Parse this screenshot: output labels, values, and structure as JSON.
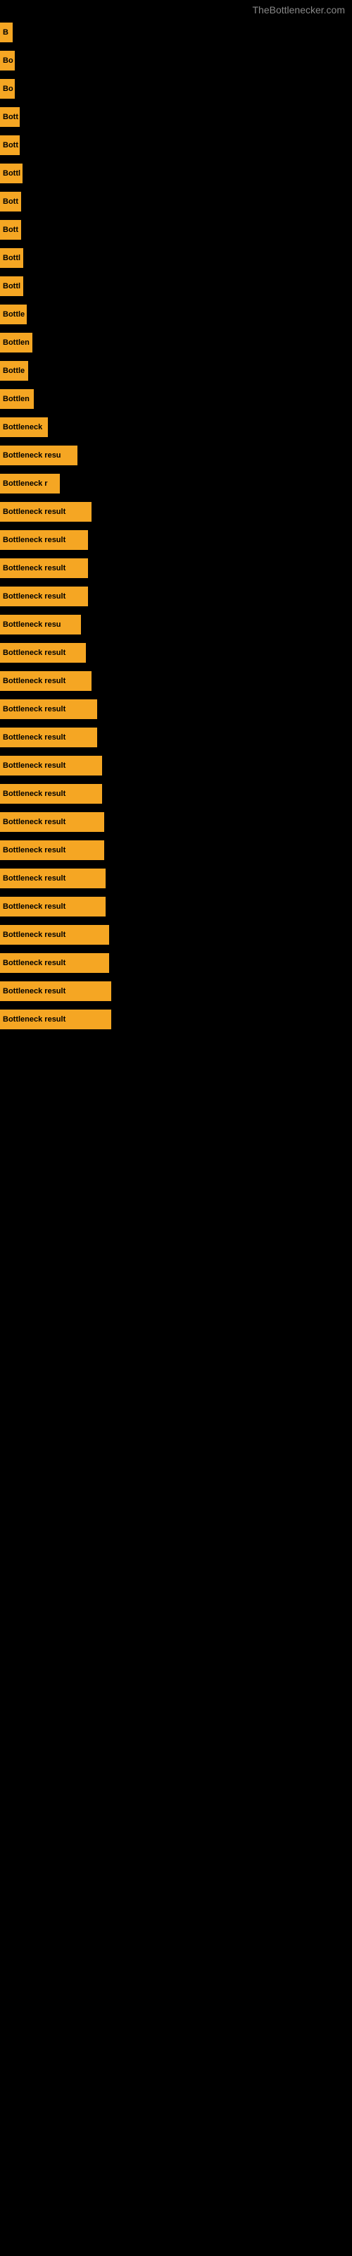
{
  "site_title": "TheBottlenecker.com",
  "bars": [
    {
      "label": "B",
      "width": 18
    },
    {
      "label": "Bo",
      "width": 21
    },
    {
      "label": "Bo",
      "width": 21
    },
    {
      "label": "Bott",
      "width": 28
    },
    {
      "label": "Bott",
      "width": 28
    },
    {
      "label": "Bottl",
      "width": 32
    },
    {
      "label": "Bott",
      "width": 30
    },
    {
      "label": "Bott",
      "width": 30
    },
    {
      "label": "Bottl",
      "width": 33
    },
    {
      "label": "Bottl",
      "width": 33
    },
    {
      "label": "Bottle",
      "width": 38
    },
    {
      "label": "Bottlen",
      "width": 46
    },
    {
      "label": "Bottle",
      "width": 40
    },
    {
      "label": "Bottlen",
      "width": 48
    },
    {
      "label": "Bottleneck",
      "width": 68
    },
    {
      "label": "Bottleneck resu",
      "width": 110
    },
    {
      "label": "Bottleneck r",
      "width": 85
    },
    {
      "label": "Bottleneck result",
      "width": 130
    },
    {
      "label": "Bottleneck result",
      "width": 125
    },
    {
      "label": "Bottleneck result",
      "width": 125
    },
    {
      "label": "Bottleneck result",
      "width": 125
    },
    {
      "label": "Bottleneck resu",
      "width": 115
    },
    {
      "label": "Bottleneck result",
      "width": 122
    },
    {
      "label": "Bottleneck result",
      "width": 130
    },
    {
      "label": "Bottleneck result",
      "width": 138
    },
    {
      "label": "Bottleneck result",
      "width": 138
    },
    {
      "label": "Bottleneck result",
      "width": 145
    },
    {
      "label": "Bottleneck result",
      "width": 145
    },
    {
      "label": "Bottleneck result",
      "width": 148
    },
    {
      "label": "Bottleneck result",
      "width": 148
    },
    {
      "label": "Bottleneck result",
      "width": 150
    },
    {
      "label": "Bottleneck result",
      "width": 150
    },
    {
      "label": "Bottleneck result",
      "width": 155
    },
    {
      "label": "Bottleneck result",
      "width": 155
    },
    {
      "label": "Bottleneck result",
      "width": 158
    },
    {
      "label": "Bottleneck result",
      "width": 158
    }
  ]
}
